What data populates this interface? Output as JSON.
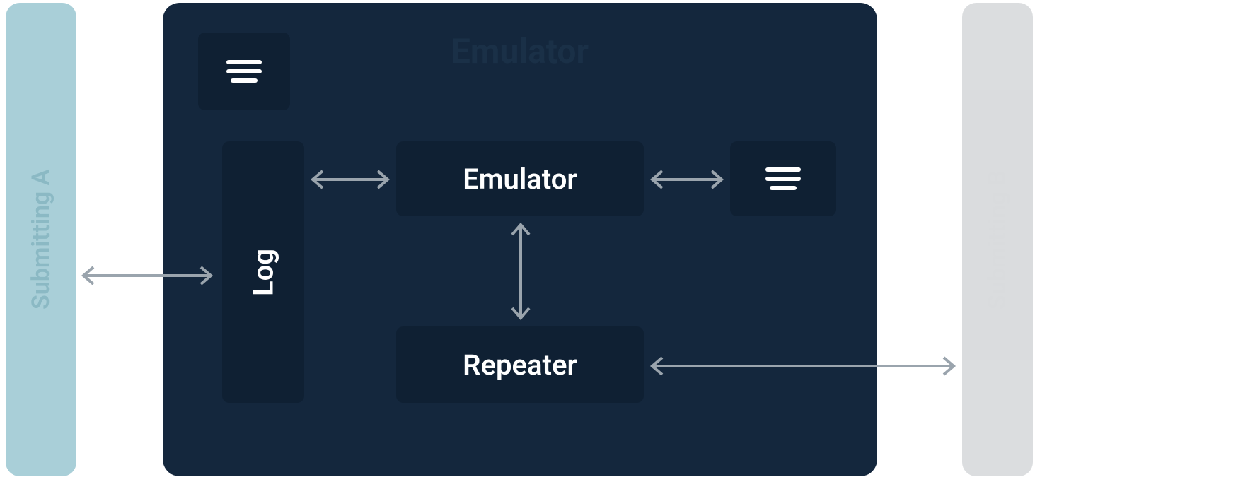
{
  "left_node": {
    "label": "Submitting A"
  },
  "right_node": {
    "label": "Submitting B"
  },
  "main_panel": {
    "title": "Emulator",
    "icon_top_left": "hamburger-icon",
    "log_label": "Log",
    "emulator_label": "Emulator",
    "icon_right": "hamburger-icon",
    "repeater_label": "Repeater"
  },
  "arrows": [
    {
      "id": "a-submittingA-log",
      "from": "submittingA",
      "to": "log",
      "bidirectional": true
    },
    {
      "id": "a-log-emulator",
      "from": "log",
      "to": "emulator",
      "bidirectional": true
    },
    {
      "id": "a-emulator-iconR",
      "from": "emulator",
      "to": "iconRight",
      "bidirectional": true
    },
    {
      "id": "a-emulator-repeater",
      "from": "emulator",
      "to": "repeater",
      "bidirectional": true
    },
    {
      "id": "a-repeater-submittingB",
      "from": "repeater",
      "to": "submittingB",
      "bidirectional": true
    }
  ]
}
